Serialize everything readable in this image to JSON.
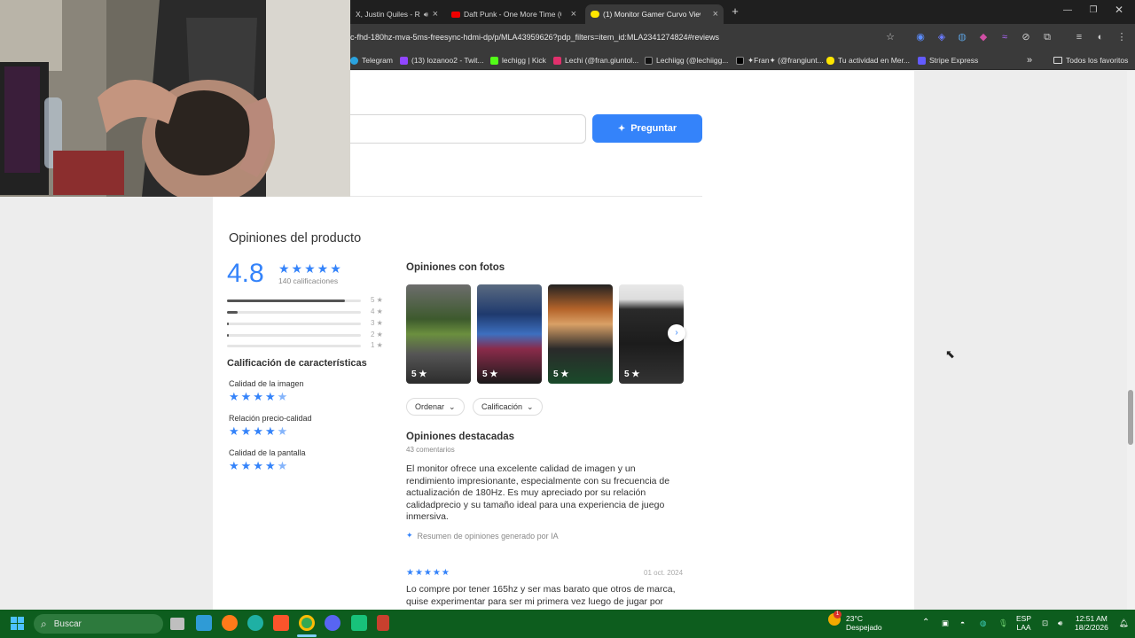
{
  "browser": {
    "tabs": [
      {
        "title": "X, Justin Quiles - R",
        "audio": true,
        "active": false
      },
      {
        "title": "Daft Punk - One More Time (Of",
        "active": false
      },
      {
        "title": "(1) Monitor Gamer Curvo View",
        "active": true
      }
    ],
    "url": "c-fhd-180hz-mva-5ms-freesync-hdmi-dp/p/MLA43959626?pdp_filters=item_id:MLA2341274824#reviews",
    "bookmarks": [
      "Telegram",
      "(13) lozanoo2 - Twit...",
      "lechigg | Kick",
      "Lechi (@fran.giuntol...",
      "Lechiigg (@lechiigg...",
      "✦Fran✦ (@frangiunt...",
      "Tu actividad en Mer...",
      "Stripe Express"
    ],
    "all_bookmarks": "Todos los favoritos"
  },
  "question": {
    "button_label": "Preguntar"
  },
  "reviews": {
    "title": "Opiniones del producto",
    "average": "4.8",
    "ratings_count": "140 calificaciones",
    "distribution": [
      {
        "stars": "5",
        "fraction": 0.88
      },
      {
        "stars": "4",
        "fraction": 0.08
      },
      {
        "stars": "3",
        "fraction": 0.01
      },
      {
        "stars": "2",
        "fraction": 0.01
      },
      {
        "stars": "1",
        "fraction": 0.0
      }
    ],
    "features_title": "Calificación de características",
    "features": [
      {
        "name": "Calidad de la imagen",
        "rating": 4.5
      },
      {
        "name": "Relación precio-calidad",
        "rating": 4.5
      },
      {
        "name": "Calidad de la pantalla",
        "rating": 4.5
      }
    ],
    "photos_title": "Opiniones con fotos",
    "photo_scores": [
      "5",
      "5",
      "5",
      "5"
    ],
    "sort_label": "Ordenar",
    "filter_label": "Calificación",
    "featured_title": "Opiniones destacadas",
    "comments_count": "43 comentarios",
    "summary": "El monitor ofrece una excelente calidad de imagen y un rendimiento impresionante, especialmente con su frecuencia de actualización de 180Hz. Es muy apreciado por su relación calidadprecio y su tamaño ideal para una experiencia de juego inmersiva.",
    "ai_note": "Resumen de opiniones generado por IA",
    "first_review": {
      "stars": "★★★★★",
      "date": "01 oct. 2024",
      "text": "Lo compre por tener 165hz y ser mas barato que otros de marca, quise experimentar para ser mi primera vez luego de jugar por"
    }
  },
  "taskbar": {
    "search_label": "Buscar",
    "weather_temp": "23°C",
    "weather_desc": "Despejado",
    "lang_top": "ESP",
    "lang_bottom": "LAA",
    "time": "12:51 AM",
    "date": "18/2/2026",
    "weather_badge": "1"
  },
  "colors": {
    "accent": "#3483fa",
    "taskbar": "#0d5d1e"
  }
}
